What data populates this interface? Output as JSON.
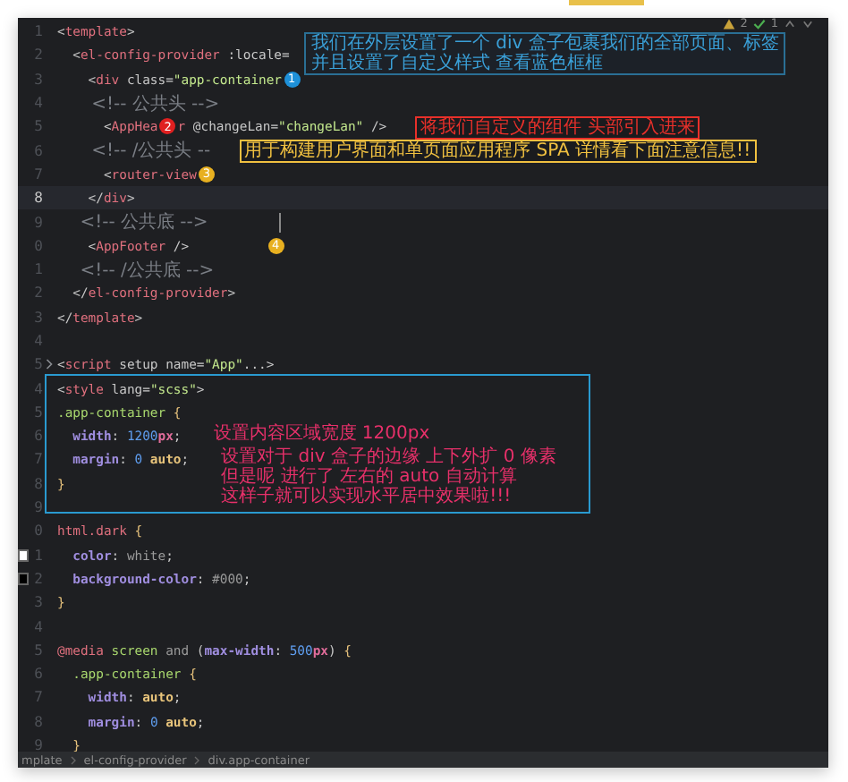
{
  "toolbar": {
    "warnings": "2",
    "checks": "1"
  },
  "callout": {
    "lines": [
      "我们在外层设置了一个 div 盒子包裹我们的全部页面、标签",
      "并且设置了自定义样式 查看蓝色框框"
    ]
  },
  "lines": [
    {
      "number": "1",
      "tokens": [
        {
          "kind": "p",
          "text": "<"
        },
        {
          "kind": "tag",
          "text": "template"
        },
        {
          "kind": "p",
          "text": ">"
        }
      ]
    },
    {
      "number": "2",
      "tokens": [
        {
          "kind": "p",
          "text": "  <"
        },
        {
          "kind": "tag",
          "text": "el-config-provider"
        },
        {
          "kind": "attr",
          "text": " :locale"
        },
        {
          "kind": "p",
          "text": "="
        }
      ]
    },
    {
      "number": "3",
      "tokens": [
        {
          "kind": "p",
          "text": "    <"
        },
        {
          "kind": "tag",
          "text": "div"
        },
        {
          "kind": "attr",
          "text": " class"
        },
        {
          "kind": "p",
          "text": "="
        },
        {
          "kind": "str",
          "text": "\"app-container"
        },
        {
          "kind": "badge",
          "text": "1",
          "color": "#1e90d8"
        }
      ]
    },
    {
      "number": "4",
      "tokens": [
        {
          "kind": "cm",
          "text": "      <!-- 公共头 -->"
        }
      ]
    },
    {
      "number": "5",
      "tokens": [
        {
          "kind": "p",
          "text": "      <"
        },
        {
          "kind": "tag",
          "text": "AppHea"
        },
        {
          "kind": "badge",
          "text": "2",
          "color": "#e02020"
        },
        {
          "kind": "tag",
          "text": "r"
        },
        {
          "kind": "attr",
          "text": " @changeLan"
        },
        {
          "kind": "p",
          "text": "="
        },
        {
          "kind": "str",
          "text": "\"changeLan\""
        },
        {
          "kind": "p",
          "text": " />"
        },
        {
          "kind": "note",
          "lines": [
            "将我们自定义的组件 头部引入进来"
          ],
          "color": "#e8302a",
          "boxed": true
        }
      ]
    },
    {
      "number": "6",
      "tokens": [
        {
          "kind": "cm",
          "text": "      <!-- /公共头 --"
        },
        {
          "kind": "note",
          "lines": [
            "用于构建用户界面和单页面应用程序 SPA 详情看下面注意信息!!"
          ],
          "color": "#f0c040",
          "boxed": true
        }
      ]
    },
    {
      "number": "7",
      "tokens": [
        {
          "kind": "p",
          "text": "      <"
        },
        {
          "kind": "tag",
          "text": "router-view"
        },
        {
          "kind": "badge",
          "text": "3",
          "color": "#e8b020"
        }
      ]
    },
    {
      "number": "8",
      "current": true,
      "tokens": [
        {
          "kind": "p",
          "text": "    </"
        },
        {
          "kind": "tag",
          "text": "div"
        },
        {
          "kind": "p",
          "text": ">"
        }
      ]
    },
    {
      "number": "9",
      "tokens": [
        {
          "kind": "cm",
          "text": "    <!-- 公共底 -->"
        },
        {
          "kind": "rule"
        }
      ]
    },
    {
      "number": "0",
      "tokens": [
        {
          "kind": "p",
          "text": "    <"
        },
        {
          "kind": "tag",
          "text": "AppFooter"
        },
        {
          "kind": "p",
          "text": " />"
        },
        {
          "kind": "badge",
          "text": "4",
          "color": "#e8b020",
          "far": true
        }
      ]
    },
    {
      "number": "1",
      "tokens": [
        {
          "kind": "cm",
          "text": "    <!-- /公共底 -->"
        }
      ]
    },
    {
      "number": "2",
      "tokens": [
        {
          "kind": "p",
          "text": "  </"
        },
        {
          "kind": "tag",
          "text": "el-config-provider"
        },
        {
          "kind": "p",
          "text": ">"
        }
      ]
    },
    {
      "number": "3",
      "tokens": [
        {
          "kind": "p",
          "text": "</"
        },
        {
          "kind": "tag",
          "text": "template"
        },
        {
          "kind": "p",
          "text": ">"
        }
      ]
    },
    {
      "number": "4"
    },
    {
      "number": "5",
      "folded": true,
      "tokens": [
        {
          "kind": "p",
          "text": "<"
        },
        {
          "kind": "tag",
          "text": "script"
        },
        {
          "kind": "attr",
          "text": " setup "
        },
        {
          "kind": "attr",
          "text": "name"
        },
        {
          "kind": "p",
          "text": "="
        },
        {
          "kind": "str",
          "text": "\"App\""
        },
        {
          "kind": "p",
          "text": "...>"
        }
      ]
    },
    {
      "number": "4",
      "tokens": [
        {
          "kind": "p",
          "text": "<"
        },
        {
          "kind": "tag",
          "text": "style"
        },
        {
          "kind": "attr",
          "text": " lang"
        },
        {
          "kind": "p",
          "text": "="
        },
        {
          "kind": "str",
          "text": "\"scss\""
        },
        {
          "kind": "p",
          "text": ">"
        }
      ]
    },
    {
      "number": "5",
      "tokens": [
        {
          "kind": "sel",
          "text": ".app-container"
        },
        {
          "kind": "brace",
          "text": " {"
        }
      ]
    },
    {
      "number": "6",
      "tokens": [
        {
          "kind": "prop",
          "text": "  width"
        },
        {
          "kind": "p",
          "text": ": "
        },
        {
          "kind": "num",
          "text": "1200"
        },
        {
          "kind": "unit",
          "text": "px"
        },
        {
          "kind": "p",
          "text": ";"
        },
        {
          "kind": "note",
          "lines": [
            "设置内容区域宽度 1200px"
          ],
          "color": "#e8306a",
          "boxed": false
        }
      ]
    },
    {
      "number": "7",
      "tokens": [
        {
          "kind": "prop",
          "text": "  margin"
        },
        {
          "kind": "p",
          "text": ": "
        },
        {
          "kind": "num",
          "text": "0"
        },
        {
          "kind": "val",
          "text": " auto"
        },
        {
          "kind": "p",
          "text": ";"
        },
        {
          "kind": "note",
          "lines": [
            "设置对于 div 盒子的边缘 上下外扩 0 像素",
            "但是呢 进行了 左右的 auto 自动计算",
            "这样子就可以实现水平居中效果啦!!!"
          ],
          "color": "#e8306a",
          "boxed": false
        }
      ]
    },
    {
      "number": "8",
      "tokens": [
        {
          "kind": "brace",
          "text": "}"
        }
      ]
    },
    {
      "number": "9"
    },
    {
      "number": "0",
      "tokens": [
        {
          "kind": "kw",
          "text": "html.dark"
        },
        {
          "kind": "brace",
          "text": " {"
        }
      ]
    },
    {
      "number": "1",
      "color": "#ffffff",
      "tokens": [
        {
          "kind": "prop",
          "text": "  color"
        },
        {
          "kind": "p",
          "text": ": "
        },
        {
          "kind": "pl",
          "text": "white"
        },
        {
          "kind": "p",
          "text": ";"
        }
      ]
    },
    {
      "number": "2",
      "color": "#000000",
      "tokens": [
        {
          "kind": "prop",
          "text": "  background-color"
        },
        {
          "kind": "p",
          "text": ": "
        },
        {
          "kind": "pl",
          "text": "#000"
        },
        {
          "kind": "p",
          "text": ";"
        }
      ]
    },
    {
      "number": "3",
      "tokens": [
        {
          "kind": "brace",
          "text": "}"
        }
      ]
    },
    {
      "number": "4"
    },
    {
      "number": "5",
      "tokens": [
        {
          "kind": "kw",
          "text": "@media"
        },
        {
          "kind": "sel",
          "text": " screen"
        },
        {
          "kind": "pl",
          "text": " and "
        },
        {
          "kind": "p",
          "text": "("
        },
        {
          "kind": "prop",
          "text": "max-width"
        },
        {
          "kind": "p",
          "text": ": "
        },
        {
          "kind": "num",
          "text": "500"
        },
        {
          "kind": "unit",
          "text": "px"
        },
        {
          "kind": "p",
          "text": ")"
        },
        {
          "kind": "brace",
          "text": " {"
        }
      ]
    },
    {
      "number": "6",
      "tokens": [
        {
          "kind": "sel",
          "text": "  .app-container"
        },
        {
          "kind": "brace",
          "text": " {"
        }
      ]
    },
    {
      "number": "7",
      "tokens": [
        {
          "kind": "prop",
          "text": "    width"
        },
        {
          "kind": "p",
          "text": ": "
        },
        {
          "kind": "val",
          "text": "auto"
        },
        {
          "kind": "p",
          "text": ";"
        }
      ]
    },
    {
      "number": "8",
      "tokens": [
        {
          "kind": "prop",
          "text": "    margin"
        },
        {
          "kind": "p",
          "text": ": "
        },
        {
          "kind": "num",
          "text": "0"
        },
        {
          "kind": "val",
          "text": " auto"
        },
        {
          "kind": "p",
          "text": ";"
        }
      ]
    },
    {
      "number": "9",
      "tokens": [
        {
          "kind": "brace",
          "text": "  }"
        }
      ]
    }
  ],
  "breadcrumbs": [
    "mplate",
    "el-config-provider",
    "div.app-container"
  ]
}
